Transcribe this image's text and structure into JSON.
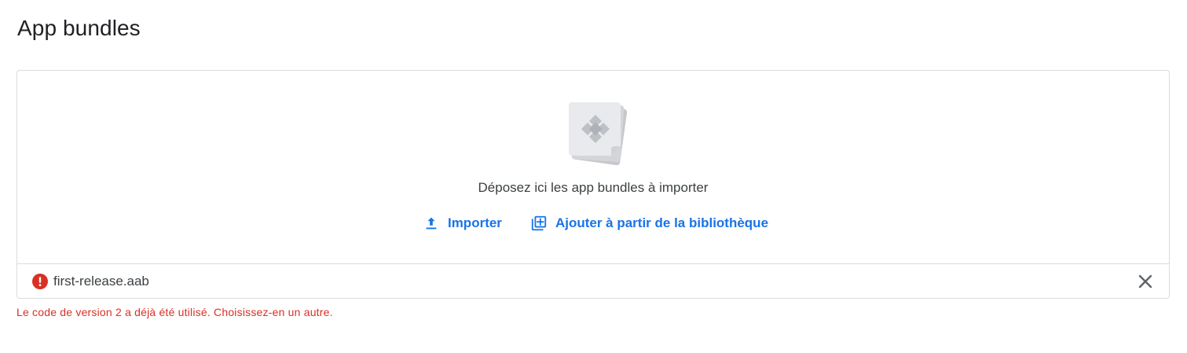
{
  "section": {
    "title": "App bundles"
  },
  "dropzone": {
    "illustration_icon": "app-bundle-icon",
    "hint": "Déposez ici les app bundles à importer",
    "actions": {
      "upload": {
        "label": "Importer",
        "icon": "upload-icon"
      },
      "library": {
        "label": "Ajouter à partir de la bibliothèque",
        "icon": "library-add-icon"
      }
    }
  },
  "file": {
    "name": "first-release.aab",
    "status_icon": "error-icon",
    "remove_icon": "close-icon"
  },
  "error": {
    "message": "Le code de version 2 a déjà été utilisé. Choisissez-en un autre."
  },
  "colors": {
    "accent": "#1a73e8",
    "error": "#d93025",
    "border": "#dadce0",
    "text": "#202124"
  }
}
